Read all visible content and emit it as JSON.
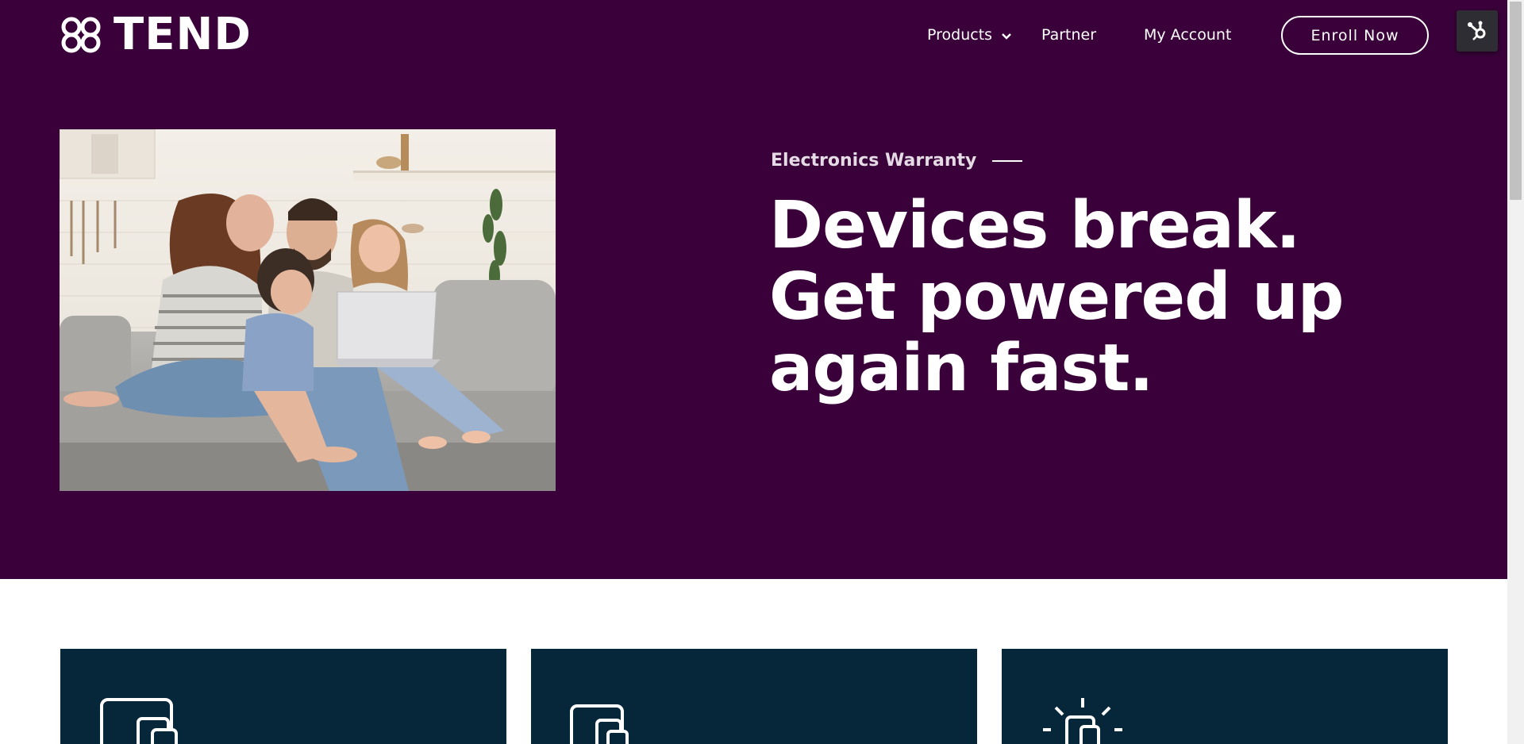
{
  "colors": {
    "hero_bg": "#3a003a",
    "card_bg": "#06263a",
    "accent_white": "#ffffff"
  },
  "header": {
    "logo_text": "TEND",
    "logo_icon": "infinity-clover-icon",
    "nav": [
      {
        "label": "Products",
        "has_dropdown": true,
        "icon": "chevron-down-icon"
      },
      {
        "label": "Partner"
      },
      {
        "label": "My Account"
      }
    ],
    "cta_label": "Enroll Now",
    "widget_icon": "hubspot-sprocket-icon"
  },
  "hero": {
    "eyebrow": "Electronics Warranty",
    "headline": [
      "Devices break.",
      "Get powered up",
      "again fast."
    ],
    "image": "family-on-couch-with-laptop-photo"
  },
  "cards": [
    {
      "icon": "devices-icon"
    },
    {
      "icon": "devices-icon"
    },
    {
      "icon": "devices-sparkle-icon"
    }
  ]
}
